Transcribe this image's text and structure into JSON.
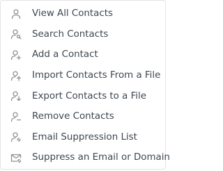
{
  "menu": {
    "items": [
      {
        "label": "View All Contacts",
        "icon": "person-icon"
      },
      {
        "label": "Search Contacts",
        "icon": "person-search-icon"
      },
      {
        "label": "Add a Contact",
        "icon": "person-add-icon"
      },
      {
        "label": "Import Contacts From a File",
        "icon": "person-import-icon"
      },
      {
        "label": "Export Contacts to a File",
        "icon": "person-export-icon"
      },
      {
        "label": "Remove Contacts",
        "icon": "person-remove-icon"
      },
      {
        "label": "Email Suppression List",
        "icon": "person-blocked-icon"
      },
      {
        "label": "Suppress an Email or Domain",
        "icon": "mail-blocked-icon"
      }
    ]
  },
  "colors": {
    "text": "#3e4650",
    "icon": "#8a9199",
    "border": "#e3e3e3",
    "background": "#ffffff"
  }
}
